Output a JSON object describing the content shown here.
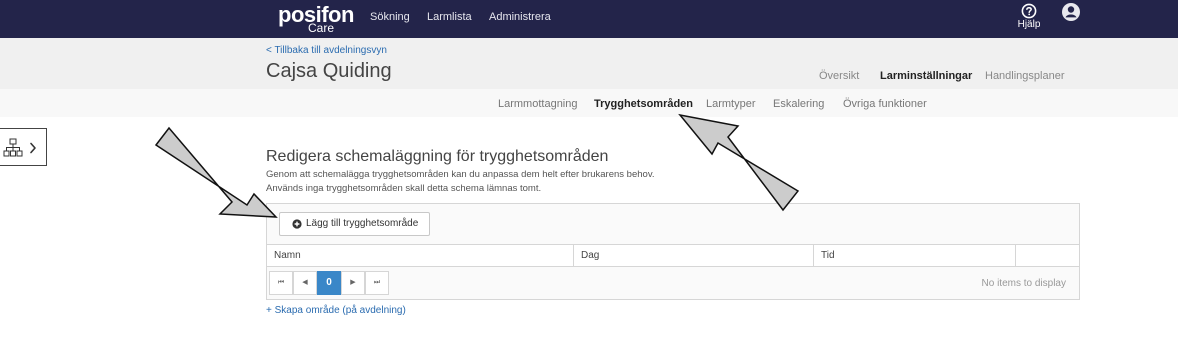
{
  "topbar": {
    "logo_brand": "posifon",
    "logo_sub": "Care",
    "nav": [
      "Sökning",
      "Larmlista",
      "Administrera"
    ],
    "help_label": "Hjälp"
  },
  "header": {
    "back_link": "< Tillbaka till avdelningsvyn",
    "title": "Cajsa Quiding",
    "tabs": [
      "Översikt",
      "Larminställningar",
      "Handlingsplaner"
    ],
    "active_tab": "Larminställningar"
  },
  "subnav": {
    "tabs": [
      "Larmmottagning",
      "Trygghetsområden",
      "Larmtyper",
      "Eskalering",
      "Övriga funktioner"
    ],
    "active_tab": "Trygghetsområden"
  },
  "main": {
    "section_title": "Redigera schemaläggning för trygghetsområden",
    "description_lines": [
      "Genom att schemalägga trygghetsområden kan du anpassa dem helt efter brukarens behov.",
      "Används inga trygghetsområden skall detta schema lämnas tomt."
    ],
    "add_button": "Lägg till trygghetsområde",
    "columns": [
      "Namn",
      "Dag",
      "Tid",
      ""
    ],
    "pager": {
      "first": "⏮",
      "prev": "◀",
      "current_page": "0",
      "next": "▶",
      "last": "⏭"
    },
    "empty_text": "No items to display",
    "create_link": "+ Skapa område (på avdelning)"
  },
  "icons": {
    "help": "question-circle-icon",
    "user": "user-circle-icon",
    "sidebar": "sitemap-icon",
    "add": "plus-circle-icon"
  },
  "colors": {
    "topbar_bg": "#23244a",
    "header_bg": "#f0f0f0",
    "link": "#2b6cb0",
    "pager_active": "#3a87c8",
    "annotation_arrow": "#cccccc"
  }
}
